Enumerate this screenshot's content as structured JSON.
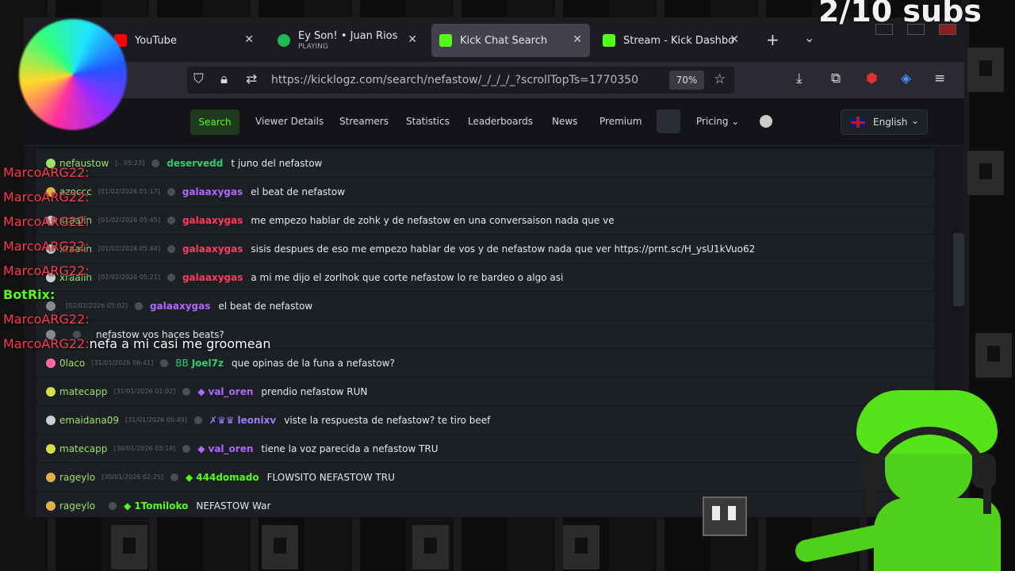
{
  "overlay": {
    "subs_counter": "2/10 subs",
    "chat": [
      {
        "name": "MarcoARG22:",
        "text": ""
      },
      {
        "name": "MarcoARG22:",
        "text": ""
      },
      {
        "name": "MarcoARG22:",
        "text": ""
      },
      {
        "name": "MarcoARG22:",
        "text": ""
      },
      {
        "name": "MarcoARG22:",
        "text": ""
      },
      {
        "name": "BotRix:",
        "text": ""
      },
      {
        "name": "MarcoARG22:",
        "text": ""
      },
      {
        "name": "MarcoARG22:",
        "text": "nefa a mi casi me groomean"
      }
    ]
  },
  "browser": {
    "tabs": [
      {
        "title": "YouTube",
        "sub": "",
        "favicon_color": "#ff0000",
        "active": false
      },
      {
        "title": "Ey Son! • Juan Rios",
        "sub": "PLAYING",
        "favicon_color": "#1db954",
        "active": false
      },
      {
        "title": "Kick Chat Search",
        "sub": "",
        "favicon_color": "#53fc18",
        "active": true
      },
      {
        "title": "Stream - Kick Dashbo",
        "sub": "",
        "favicon_color": "#53fc18",
        "active": false
      }
    ],
    "url": "https://kicklogz.com/search/nefastow/_/_/_/_?scrollTopTs=1770350",
    "zoom": "70%"
  },
  "site": {
    "nav": {
      "search": "Search",
      "viewer_details": "Viewer Details",
      "streamers": "Streamers",
      "statistics": "Statistics",
      "leaderboards": "Leaderboards",
      "news": "News",
      "premium": "Premium",
      "pricing": "Pricing",
      "language": "English"
    },
    "accent": "#53fc18",
    "rows": [
      {
        "user": "nefaustow",
        "ts": "[.. 05:23]",
        "sender": "deservedd",
        "sender_color": "#2ecc71",
        "badge": "",
        "msg": "t juno del nefastow"
      },
      {
        "user": "azoccc",
        "ts": "[01/02/2026 01:17]",
        "sender": "galaaxygas",
        "sender_color": "#b066ff",
        "badge": "",
        "msg": "el beat de nefastow"
      },
      {
        "user": "xraaiin",
        "ts": "[01/02/2026 05:45]",
        "sender": "galaaxygas",
        "sender_color": "#ff3b5c",
        "badge": "",
        "msg": "me empezo hablar de zohk y de nefastow en una conversaison nada que ve"
      },
      {
        "user": "xraaiin",
        "ts": "[01/02/2026 05:44]",
        "sender": "galaaxygas",
        "sender_color": "#ff3b5c",
        "badge": "",
        "msg": "sisis despues de eso me empezo hablar de vos y de nefastow nada que ver https://prnt.sc/H_ysU1kVuo62"
      },
      {
        "user": "xraaiin",
        "ts": "[02/02/2026 05:21]",
        "sender": "galaaxygas",
        "sender_color": "#ff3b5c",
        "badge": "",
        "msg": "a mi me dijo el zorlhok que corte nefastow lo re bardeo o algo asi"
      },
      {
        "user": "",
        "ts": "[02/02/2026 05:02]",
        "sender": "galaaxygas",
        "sender_color": "#b066ff",
        "badge": "",
        "msg": "el beat de nefastow"
      },
      {
        "user": "",
        "ts": "",
        "sender": "",
        "sender_color": "#b066ff",
        "badge": "",
        "msg": "nefastow vos haces beats?"
      },
      {
        "user": "0laco",
        "ts": "[31/01/2026 06:41]",
        "sender": "Joel7z",
        "sender_color": "#2ecc71",
        "badge": "BB",
        "msg": "que opinas de la funa a nefastow?"
      },
      {
        "user": "matecapp",
        "ts": "[31/01/2026 01:02]",
        "sender": "val_oren",
        "sender_color": "#b066ff",
        "badge": "◆",
        "msg": "prendio nefastow RUN"
      },
      {
        "user": "emaidana09",
        "ts": "[31/01/2026 00:49]",
        "sender": "leonixv",
        "sender_color": "#9f7bff",
        "badge": "✗♛♛",
        "msg": "viste la respuesta de nefastow? te tiro beef"
      },
      {
        "user": "matecapp",
        "ts": "[30/01/2026 03:18]",
        "sender": "val_oren",
        "sender_color": "#b066ff",
        "badge": "◆",
        "msg": "tiene la voz parecida a nefastow TRU"
      },
      {
        "user": "rageylo",
        "ts": "[30/01/2026 02:25]",
        "sender": "444domado",
        "sender_color": "#53fc18",
        "badge": "◆",
        "msg": "FLOWSITO NEFASTOW TRU"
      },
      {
        "user": "rageylo",
        "ts": "",
        "sender": "1Tomiloko",
        "sender_color": "#53fc18",
        "badge": "◆",
        "msg": "NEFASTOW War"
      }
    ]
  }
}
